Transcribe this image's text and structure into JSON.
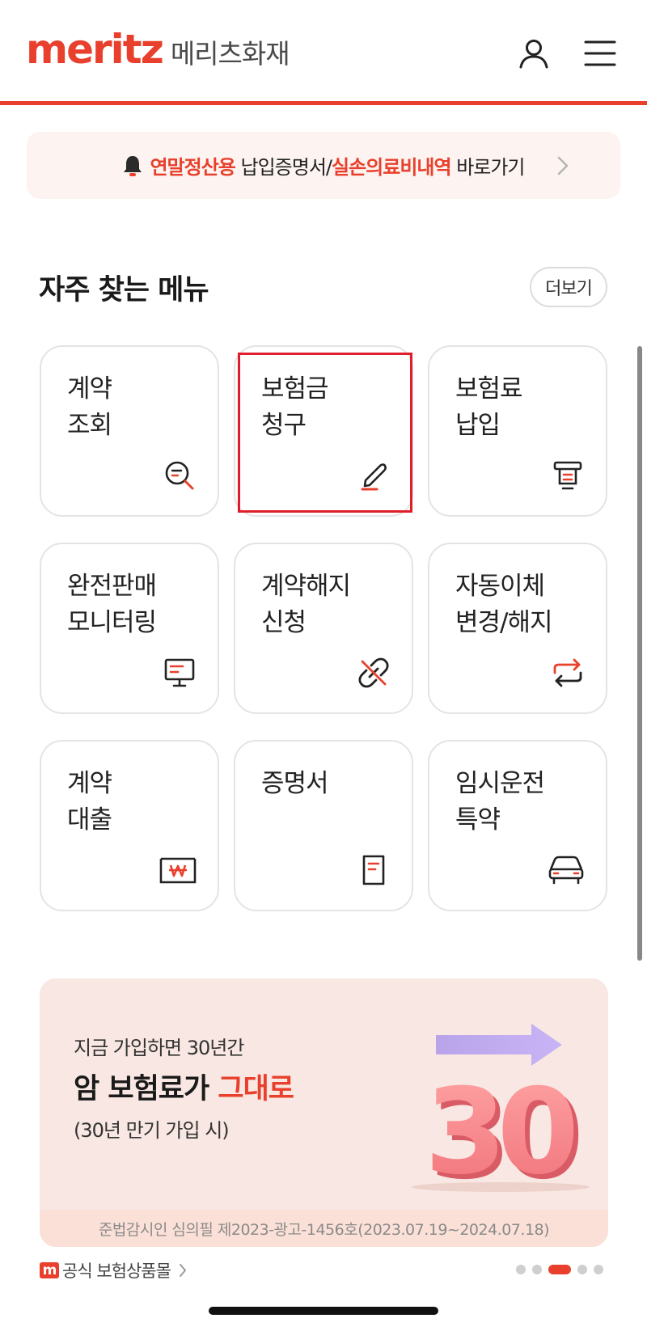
{
  "header": {
    "logo_word": "meritz",
    "logo_korean": "메리츠화재",
    "user_icon": "user-icon",
    "menu_icon": "hamburger-menu-icon",
    "accent_color": "#e8402c"
  },
  "notice": {
    "icon": "bell-icon",
    "part1": "연말정산용",
    "part2": " 납입증명서/",
    "part3": "실손의료비내역",
    "part4": " 바로가기"
  },
  "section": {
    "title": "자주 찾는 메뉴",
    "more_label": "더보기"
  },
  "menu_items": [
    {
      "label": "계약\n조회",
      "icon": "search-document-icon"
    },
    {
      "label": "보험금\n청구",
      "icon": "pen-icon"
    },
    {
      "label": "보험료\n납입",
      "icon": "payment-terminal-icon"
    },
    {
      "label": "완전판매\n모니터링",
      "icon": "monitor-icon"
    },
    {
      "label": "계약해지\n신청",
      "icon": "unlink-icon"
    },
    {
      "label": "자동이체\n변경/해지",
      "icon": "transfer-arrows-icon"
    },
    {
      "label": "계약\n대출",
      "icon": "won-bill-icon"
    },
    {
      "label": "증명서",
      "icon": "certificate-document-icon"
    },
    {
      "label": "임시운전\n특약",
      "icon": "car-icon"
    }
  ],
  "promo": {
    "line1": "지금 가입하면 30년간",
    "line2_main": "암 보험료가 ",
    "line2_accent": "그대로",
    "line3": "(30년 만기 가입 시)",
    "graphic_number": "30",
    "footnote": "준법감시인 심의필 제2023-광고-1456호(2023.07.19~2024.07.18)"
  },
  "bottom": {
    "shop_badge": "m",
    "shop_label": "공식 보험상품몰",
    "pager_count": 5,
    "pager_active": 3
  }
}
